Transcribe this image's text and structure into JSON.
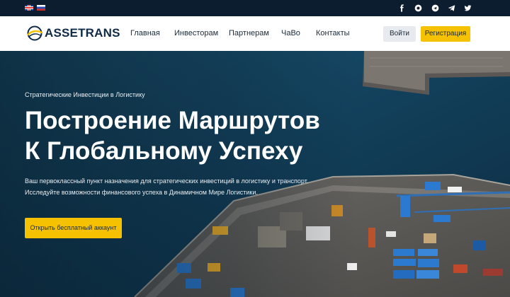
{
  "topbar": {
    "languages": [
      {
        "code": "en",
        "icon": "uk-flag-icon"
      },
      {
        "code": "ru",
        "icon": "ru-flag-icon"
      }
    ],
    "social": [
      "facebook-icon",
      "instagram-icon",
      "telegram-icon",
      "telegram-send-icon",
      "twitter-icon"
    ]
  },
  "header": {
    "logo_text": "ASSETRANS",
    "nav": [
      "Главная",
      "Инвесторам",
      "Партнерам",
      "ЧаВо",
      "Контакты"
    ],
    "login_label": "Войти",
    "register_label": "Регистрация"
  },
  "hero": {
    "tagline": "Стратегические Инвестиции в Логистику",
    "title_line1": "Построение Маршрутов",
    "title_line2": "К Глобальному Успеху",
    "desc_line1": "Ваш первоклассный пункт назначения для стратегических инвестиций в логистику и транспорт.",
    "desc_line2": "Исследуйте возможности финансового успеха в Динамичном Мире Логистики.",
    "cta_label": "Открыть бесплатный аккаунт"
  },
  "colors": {
    "accent": "#f6c100",
    "topbar_bg": "#0c1d30",
    "brand_navy": "#0e2a47"
  }
}
